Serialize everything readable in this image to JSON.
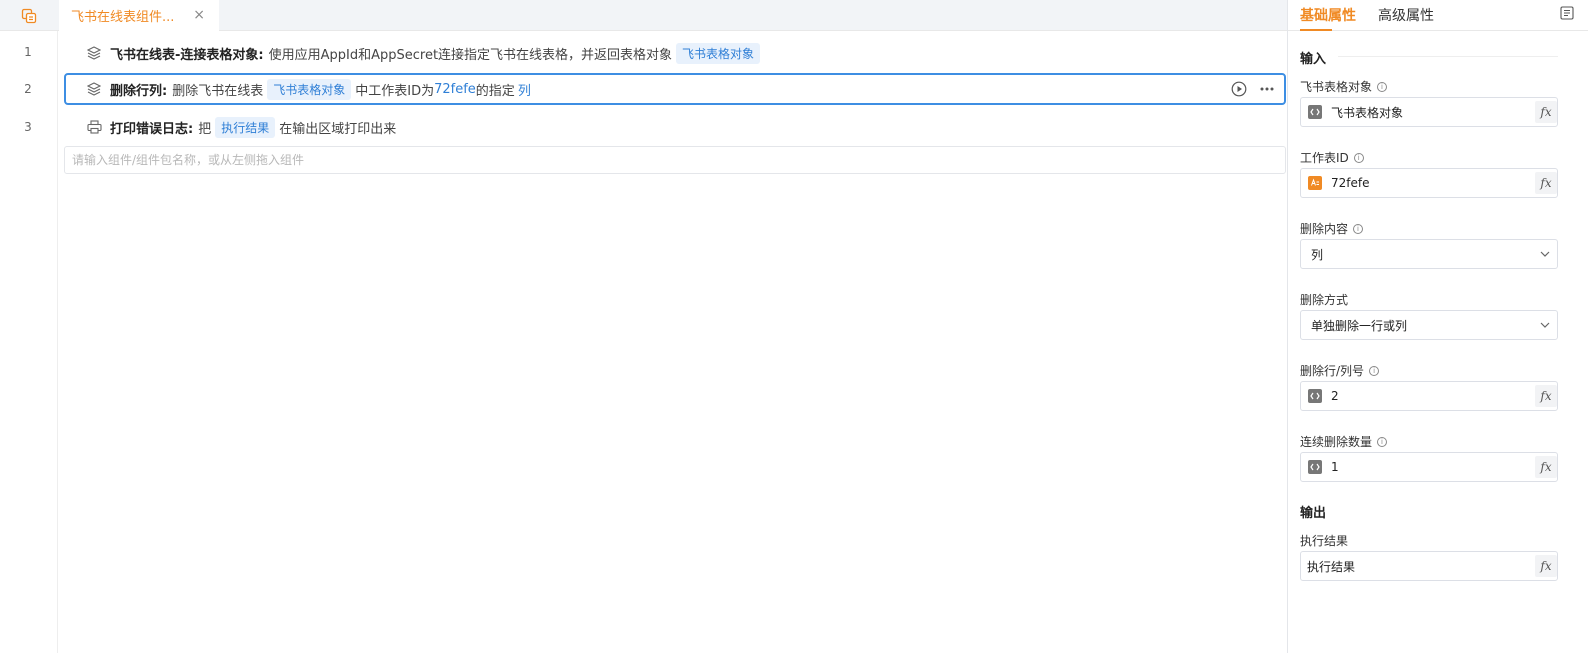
{
  "editor": {
    "tab": {
      "title": "飞书在线表组件...",
      "close": "×"
    },
    "line_numbers": [
      "1",
      "2",
      "3"
    ],
    "rows": [
      {
        "title": "飞书在线表-连接表格对象:",
        "desc": "使用应用AppId和AppSecret连接指定飞书在线表格，并返回表格对象",
        "chip": "飞书表格对象"
      },
      {
        "title": "删除行列:",
        "t1": "删除飞书在线表",
        "chip": "飞书表格对象",
        "t2": "中工作表ID为",
        "v1": "72fefe",
        "t3": "的指定",
        "v2": "列"
      },
      {
        "title": "打印错误日志:",
        "t1": "把",
        "chip": "执行结果",
        "t2": "在输出区域打印出来"
      }
    ],
    "command_placeholder": "请输入组件/组件包名称，或从左侧拖入组件"
  },
  "panel": {
    "tabs": [
      "基础属性",
      "高级属性"
    ],
    "input_title": "输入",
    "output_title": "输出",
    "fields": [
      {
        "label": "飞书表格对象",
        "value": "飞书表格对象"
      },
      {
        "label": "工作表ID",
        "value": "72fefe"
      },
      {
        "label": "删除内容",
        "value": "列"
      },
      {
        "label": "删除方式",
        "value": "单独删除一行或列"
      },
      {
        "label": "删除行/列号",
        "value": "2"
      },
      {
        "label": "连续删除数量",
        "value": "1"
      }
    ],
    "output_field": {
      "label": "执行结果",
      "value": "执行结果"
    },
    "fx_label": "fx",
    "info_glyph": "i"
  },
  "colors": {
    "accent": "#f08a24",
    "link": "#2f7fd6",
    "selected_border": "#3d8ee3"
  }
}
